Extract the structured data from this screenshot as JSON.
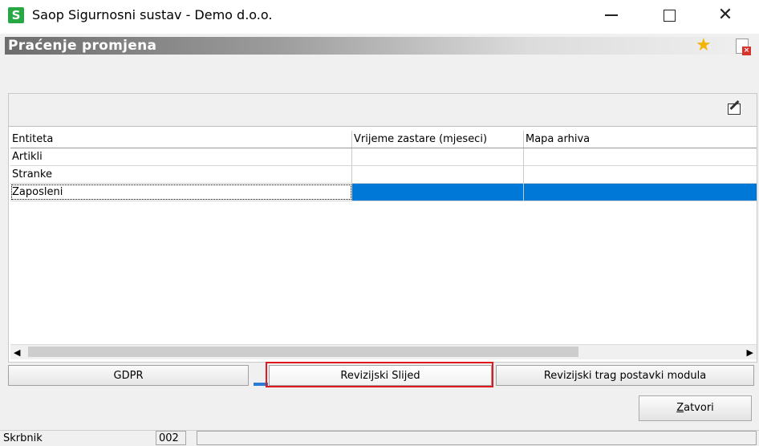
{
  "window": {
    "app_icon_letter": "S",
    "title": "Saop Sigurnosni sustav - Demo d.o.o."
  },
  "header": {
    "title": "Praćenje promjena"
  },
  "grid": {
    "columns": [
      "Entiteta",
      "Vrijeme zastare (mjeseci)",
      "Mapa arhiva"
    ],
    "rows": [
      {
        "entiteta": "Artikli",
        "vrijeme": "",
        "mapa": ""
      },
      {
        "entiteta": "Stranke",
        "vrijeme": "",
        "mapa": ""
      },
      {
        "entiteta": "Zaposleni",
        "vrijeme": "",
        "mapa": ""
      }
    ],
    "selected_row": "Zaposleni"
  },
  "tabs": [
    {
      "label": "GDPR"
    },
    {
      "label": "Revizijski Slijed"
    },
    {
      "label": "Revizijski trag postavki modula"
    }
  ],
  "buttons": {
    "close_underlined": "Z",
    "close_rest": "atvori"
  },
  "statusbar": {
    "user": "Skrbnik",
    "code": "002"
  },
  "colors": {
    "selection": "#0078d7",
    "highlight": "#e0191f",
    "app_icon": "#28a745"
  }
}
